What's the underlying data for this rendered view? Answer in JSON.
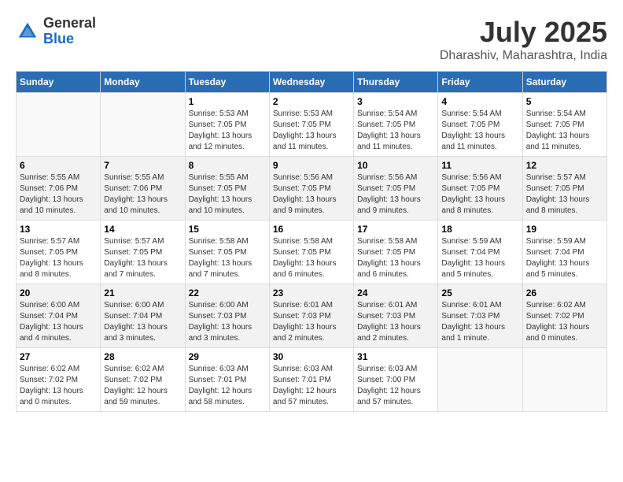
{
  "header": {
    "logo_general": "General",
    "logo_blue": "Blue",
    "month_title": "July 2025",
    "location": "Dharashiv, Maharashtra, India"
  },
  "weekdays": [
    "Sunday",
    "Monday",
    "Tuesday",
    "Wednesday",
    "Thursday",
    "Friday",
    "Saturday"
  ],
  "weeks": [
    [
      {
        "day": "",
        "info": ""
      },
      {
        "day": "",
        "info": ""
      },
      {
        "day": "1",
        "info": "Sunrise: 5:53 AM\nSunset: 7:05 PM\nDaylight: 13 hours\nand 12 minutes."
      },
      {
        "day": "2",
        "info": "Sunrise: 5:53 AM\nSunset: 7:05 PM\nDaylight: 13 hours\nand 11 minutes."
      },
      {
        "day": "3",
        "info": "Sunrise: 5:54 AM\nSunset: 7:05 PM\nDaylight: 13 hours\nand 11 minutes."
      },
      {
        "day": "4",
        "info": "Sunrise: 5:54 AM\nSunset: 7:05 PM\nDaylight: 13 hours\nand 11 minutes."
      },
      {
        "day": "5",
        "info": "Sunrise: 5:54 AM\nSunset: 7:05 PM\nDaylight: 13 hours\nand 11 minutes."
      }
    ],
    [
      {
        "day": "6",
        "info": "Sunrise: 5:55 AM\nSunset: 7:06 PM\nDaylight: 13 hours\nand 10 minutes."
      },
      {
        "day": "7",
        "info": "Sunrise: 5:55 AM\nSunset: 7:06 PM\nDaylight: 13 hours\nand 10 minutes."
      },
      {
        "day": "8",
        "info": "Sunrise: 5:55 AM\nSunset: 7:05 PM\nDaylight: 13 hours\nand 10 minutes."
      },
      {
        "day": "9",
        "info": "Sunrise: 5:56 AM\nSunset: 7:05 PM\nDaylight: 13 hours\nand 9 minutes."
      },
      {
        "day": "10",
        "info": "Sunrise: 5:56 AM\nSunset: 7:05 PM\nDaylight: 13 hours\nand 9 minutes."
      },
      {
        "day": "11",
        "info": "Sunrise: 5:56 AM\nSunset: 7:05 PM\nDaylight: 13 hours\nand 8 minutes."
      },
      {
        "day": "12",
        "info": "Sunrise: 5:57 AM\nSunset: 7:05 PM\nDaylight: 13 hours\nand 8 minutes."
      }
    ],
    [
      {
        "day": "13",
        "info": "Sunrise: 5:57 AM\nSunset: 7:05 PM\nDaylight: 13 hours\nand 8 minutes."
      },
      {
        "day": "14",
        "info": "Sunrise: 5:57 AM\nSunset: 7:05 PM\nDaylight: 13 hours\nand 7 minutes."
      },
      {
        "day": "15",
        "info": "Sunrise: 5:58 AM\nSunset: 7:05 PM\nDaylight: 13 hours\nand 7 minutes."
      },
      {
        "day": "16",
        "info": "Sunrise: 5:58 AM\nSunset: 7:05 PM\nDaylight: 13 hours\nand 6 minutes."
      },
      {
        "day": "17",
        "info": "Sunrise: 5:58 AM\nSunset: 7:05 PM\nDaylight: 13 hours\nand 6 minutes."
      },
      {
        "day": "18",
        "info": "Sunrise: 5:59 AM\nSunset: 7:04 PM\nDaylight: 13 hours\nand 5 minutes."
      },
      {
        "day": "19",
        "info": "Sunrise: 5:59 AM\nSunset: 7:04 PM\nDaylight: 13 hours\nand 5 minutes."
      }
    ],
    [
      {
        "day": "20",
        "info": "Sunrise: 6:00 AM\nSunset: 7:04 PM\nDaylight: 13 hours\nand 4 minutes."
      },
      {
        "day": "21",
        "info": "Sunrise: 6:00 AM\nSunset: 7:04 PM\nDaylight: 13 hours\nand 3 minutes."
      },
      {
        "day": "22",
        "info": "Sunrise: 6:00 AM\nSunset: 7:03 PM\nDaylight: 13 hours\nand 3 minutes."
      },
      {
        "day": "23",
        "info": "Sunrise: 6:01 AM\nSunset: 7:03 PM\nDaylight: 13 hours\nand 2 minutes."
      },
      {
        "day": "24",
        "info": "Sunrise: 6:01 AM\nSunset: 7:03 PM\nDaylight: 13 hours\nand 2 minutes."
      },
      {
        "day": "25",
        "info": "Sunrise: 6:01 AM\nSunset: 7:03 PM\nDaylight: 13 hours\nand 1 minute."
      },
      {
        "day": "26",
        "info": "Sunrise: 6:02 AM\nSunset: 7:02 PM\nDaylight: 13 hours\nand 0 minutes."
      }
    ],
    [
      {
        "day": "27",
        "info": "Sunrise: 6:02 AM\nSunset: 7:02 PM\nDaylight: 13 hours\nand 0 minutes."
      },
      {
        "day": "28",
        "info": "Sunrise: 6:02 AM\nSunset: 7:02 PM\nDaylight: 12 hours\nand 59 minutes."
      },
      {
        "day": "29",
        "info": "Sunrise: 6:03 AM\nSunset: 7:01 PM\nDaylight: 12 hours\nand 58 minutes."
      },
      {
        "day": "30",
        "info": "Sunrise: 6:03 AM\nSunset: 7:01 PM\nDaylight: 12 hours\nand 57 minutes."
      },
      {
        "day": "31",
        "info": "Sunrise: 6:03 AM\nSunset: 7:00 PM\nDaylight: 12 hours\nand 57 minutes."
      },
      {
        "day": "",
        "info": ""
      },
      {
        "day": "",
        "info": ""
      }
    ]
  ]
}
